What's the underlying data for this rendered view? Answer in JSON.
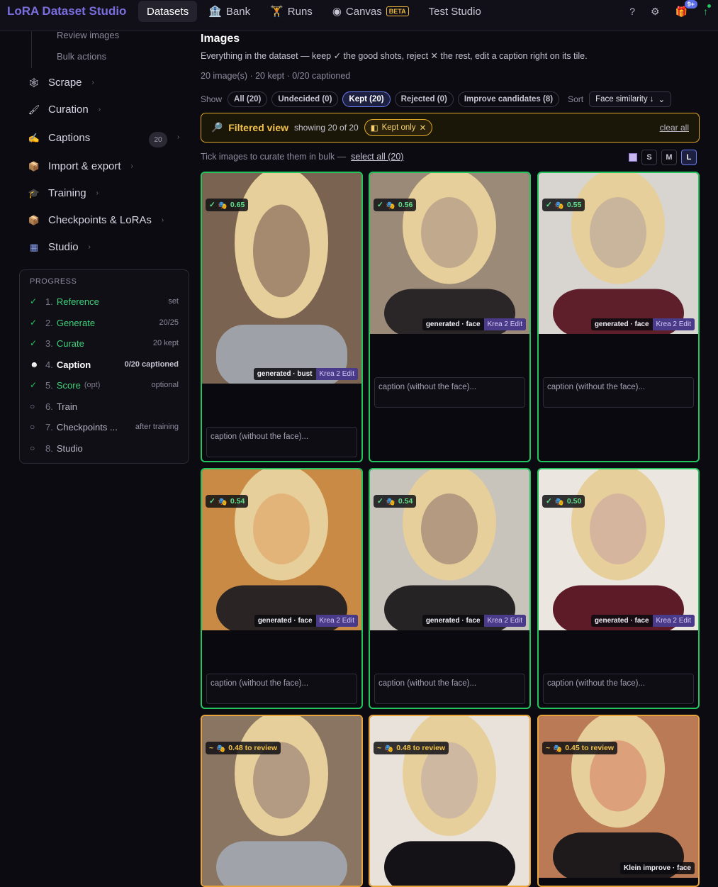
{
  "header": {
    "brand": "LoRA Dataset Studio",
    "tabs": [
      {
        "label": "Datasets",
        "icon": ""
      },
      {
        "label": "Bank",
        "icon": "bank-icon"
      },
      {
        "label": "Runs",
        "icon": "runner-icon"
      },
      {
        "label": "Canvas",
        "icon": "canvas-icon",
        "badge": "BETA"
      },
      {
        "label": "Test Studio",
        "icon": ""
      }
    ],
    "help": "?",
    "settings": "⚙",
    "gift_count": "9+",
    "update": "↑"
  },
  "sidebar": {
    "sub_items": [
      "Review images",
      "Bulk actions"
    ],
    "items": [
      {
        "label": "Scrape",
        "icon": "🕸"
      },
      {
        "label": "Curation",
        "icon": "🖌"
      },
      {
        "label": "Captions",
        "icon": "✍",
        "count": "20"
      },
      {
        "label": "Import & export",
        "icon": "📦"
      },
      {
        "label": "Training",
        "icon": "🎓"
      },
      {
        "label": "Checkpoints & LoRAs",
        "icon": "📦"
      },
      {
        "label": "Studio",
        "icon": "▦"
      }
    ],
    "progress": {
      "title": "PROGRESS",
      "steps": [
        {
          "mark": "✓",
          "num": "1.",
          "label": "Reference",
          "note": "set"
        },
        {
          "mark": "✓",
          "num": "2.",
          "label": "Generate",
          "note": "20/25"
        },
        {
          "mark": "✓",
          "num": "3.",
          "label": "Curate",
          "note": "20 kept"
        },
        {
          "mark": "☻",
          "num": "4.",
          "label": "Caption",
          "note": "0/20 captioned"
        },
        {
          "mark": "✓",
          "num": "5.",
          "label": "Score",
          "opt": "(opt)",
          "note": "optional"
        },
        {
          "mark": "○",
          "num": "6.",
          "label": "Train",
          "note": ""
        },
        {
          "mark": "○",
          "num": "7.",
          "label": "Checkpoints ...",
          "note": "after training"
        },
        {
          "mark": "○",
          "num": "8.",
          "label": "Studio",
          "note": ""
        }
      ]
    }
  },
  "main": {
    "title": "Images",
    "subtitle": "Everything in the dataset — keep ✓ the good shots, reject ✕ the rest, edit a caption right on its tile.",
    "stats": "20 image(s) · 20 kept · 0/20 captioned",
    "show_label": "Show",
    "filters": [
      "All (20)",
      "Undecided (0)",
      "Kept (20)",
      "Rejected (0)",
      "Improve candidates (8)"
    ],
    "sort_label": "Sort",
    "sort_value": "Face similarity ↓",
    "filter_bar": {
      "title": "Filtered view",
      "showing": "showing 20 of 20",
      "chip": "Kept only",
      "clear": "clear all"
    },
    "bulk_text": "Tick images to curate them in bulk —",
    "select_all": "select all (20)",
    "sizes": [
      "S",
      "M",
      "L"
    ],
    "caption_placeholder": "caption (without the face)...",
    "cards": [
      {
        "score": "0.65",
        "tag": "generated · bust",
        "model": "Krea 2 Edit",
        "status": "kept"
      },
      {
        "score": "0.56",
        "tag": "generated · face",
        "model": "Krea 2 Edit",
        "status": "kept"
      },
      {
        "score": "0.55",
        "tag": "generated · face",
        "model": "Krea 2 Edit",
        "status": "kept"
      },
      {
        "score": "0.54",
        "tag": "generated · face",
        "model": "Krea 2 Edit",
        "status": "kept"
      },
      {
        "score": "0.54",
        "tag": "generated · face",
        "model": "Krea 2 Edit",
        "status": "kept"
      },
      {
        "score": "0.50",
        "tag": "generated · face",
        "model": "Krea 2 Edit",
        "status": "kept"
      },
      {
        "score": "0.48 to review",
        "tag": "",
        "model": "",
        "status": "review"
      },
      {
        "score": "0.48 to review",
        "tag": "",
        "model": "",
        "status": "review"
      },
      {
        "score": "0.45 to review",
        "tag": "Klein improve · face",
        "model": "",
        "status": "review"
      }
    ]
  }
}
